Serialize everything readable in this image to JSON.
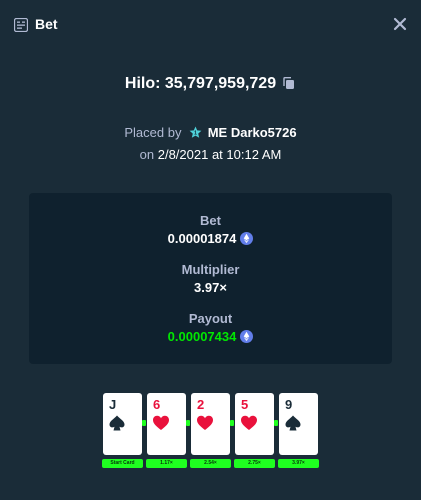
{
  "header": {
    "title": "Bet",
    "header_icon": "bet-receipt-icon",
    "close_icon": "close-icon"
  },
  "bet_title": {
    "text": "Hilo: 35,797,959,729",
    "copy_icon": "copy-icon"
  },
  "placed": {
    "prefix": "Placed by",
    "vip_icon": "vip-rank-icon",
    "username": "ME Darko5726",
    "date_prefix": "on",
    "date": "2/8/2021 at 10:12 AM"
  },
  "stats": {
    "bet_label": "Bet",
    "bet_value": "0.00001874",
    "multiplier_label": "Multiplier",
    "multiplier_value": "3.97×",
    "payout_label": "Payout",
    "payout_value": "0.00007434",
    "currency_icon": "ethereum-icon"
  },
  "cards": [
    {
      "rank": "J",
      "suit": "spade",
      "color": "black",
      "chip": "Start Card"
    },
    {
      "rank": "6",
      "suit": "heart",
      "color": "red",
      "chip": "1.17×"
    },
    {
      "rank": "2",
      "suit": "heart",
      "color": "red",
      "chip": "2.54×"
    },
    {
      "rank": "5",
      "suit": "heart",
      "color": "red",
      "chip": "2.75×"
    },
    {
      "rank": "9",
      "suit": "spade",
      "color": "black",
      "chip": "3.97×"
    }
  ],
  "colors": {
    "background": "#1a2c38",
    "panel": "#0f212e",
    "muted_text": "#b1bad3",
    "green": "#00e701",
    "chip_green": "#1fff20",
    "red_suit": "#e9113c",
    "eth": "#627eea"
  }
}
